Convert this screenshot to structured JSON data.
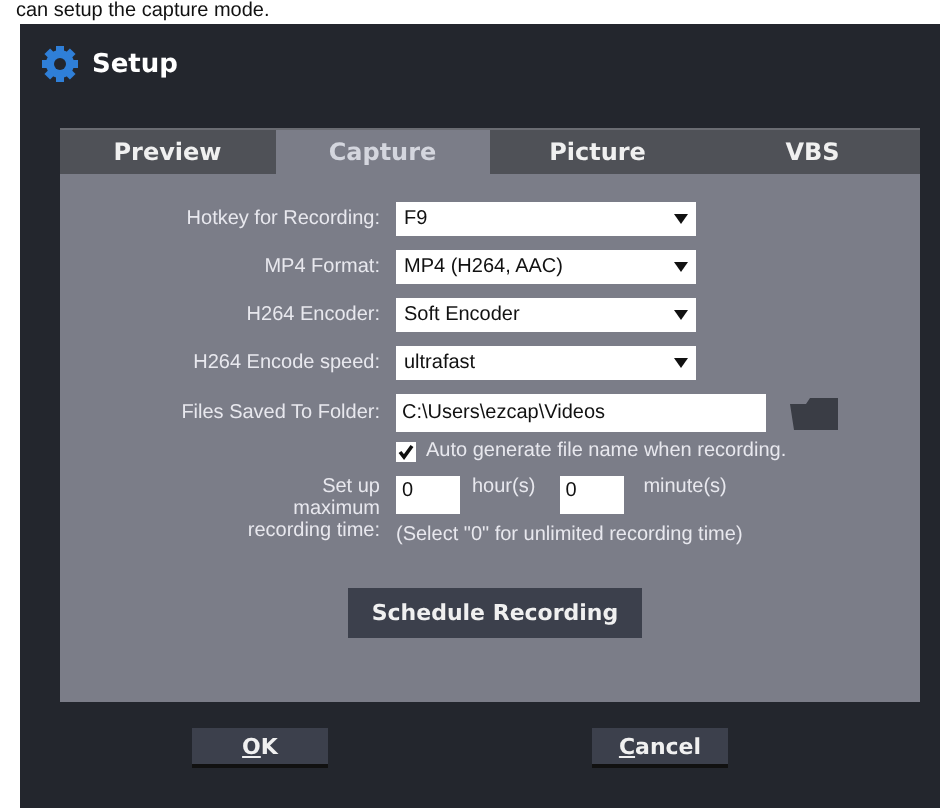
{
  "caption": "can setup the capture mode.",
  "window": {
    "title": "Setup"
  },
  "tabs": [
    {
      "label": "Preview",
      "selected": false
    },
    {
      "label": "Capture",
      "selected": true
    },
    {
      "label": "Picture",
      "selected": false
    },
    {
      "label": "VBS",
      "selected": false
    }
  ],
  "selects": [
    {
      "label": "Hotkey for Recording:",
      "value": "F9"
    },
    {
      "label": "MP4 Format:",
      "value": "MP4 (H264, AAC)"
    },
    {
      "label": "H264 Encoder:",
      "value": "Soft Encoder"
    },
    {
      "label": "H264 Encode speed:",
      "value": "ultrafast"
    }
  ],
  "folder": {
    "label": "Files Saved To Folder:",
    "value": "C:\\Users\\ezcap\\Videos"
  },
  "auto_name": {
    "label": "Auto generate file name when recording.",
    "checked": true
  },
  "max_time": {
    "label": "Set up maximum recording time:",
    "hours": "0",
    "hours_unit": "hour(s)",
    "minutes": "0",
    "minutes_unit": "minute(s)",
    "hint": "(Select \"0\" for unlimited recording time)"
  },
  "schedule_button": "Schedule Recording",
  "buttons": [
    "OK",
    "Cancel"
  ]
}
